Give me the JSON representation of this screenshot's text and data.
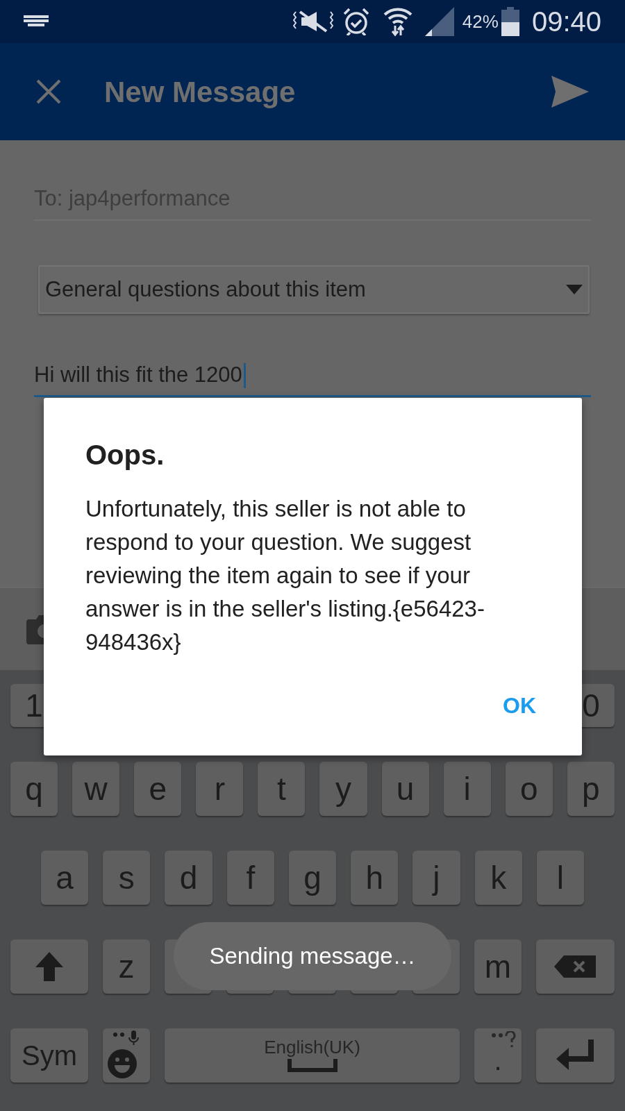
{
  "status_bar": {
    "battery": "42%",
    "time": "09:40"
  },
  "toolbar": {
    "title": "New Message"
  },
  "form": {
    "to": "To: jap4performance",
    "topic": "General questions about this item",
    "message": "Hi will this fit the 1200"
  },
  "keyboard": {
    "number_row": [
      "1",
      "0"
    ],
    "rows": [
      {
        "keys": [
          {
            "kind": "char",
            "label": "q"
          },
          {
            "kind": "char",
            "label": "w"
          },
          {
            "kind": "char",
            "label": "e"
          },
          {
            "kind": "char",
            "label": "r"
          },
          {
            "kind": "char",
            "label": "t"
          },
          {
            "kind": "char",
            "label": "y"
          },
          {
            "kind": "char",
            "label": "u"
          },
          {
            "kind": "char",
            "label": "i"
          },
          {
            "kind": "char",
            "label": "o"
          },
          {
            "kind": "char",
            "label": "p"
          }
        ]
      },
      {
        "keys": [
          {
            "kind": "char",
            "label": "a"
          },
          {
            "kind": "char",
            "label": "s"
          },
          {
            "kind": "char",
            "label": "d"
          },
          {
            "kind": "char",
            "label": "f"
          },
          {
            "kind": "char",
            "label": "g"
          },
          {
            "kind": "char",
            "label": "h"
          },
          {
            "kind": "char",
            "label": "j"
          },
          {
            "kind": "char",
            "label": "k"
          },
          {
            "kind": "char",
            "label": "l"
          }
        ]
      },
      {
        "keys": [
          {
            "kind": "shift"
          },
          {
            "kind": "char",
            "label": "z"
          },
          {
            "kind": "char"
          },
          {
            "kind": "char"
          },
          {
            "kind": "char"
          },
          {
            "kind": "char"
          },
          {
            "kind": "char"
          },
          {
            "kind": "char",
            "label": "m"
          },
          {
            "kind": "backspace"
          }
        ]
      },
      {
        "keys": [
          {
            "kind": "sym",
            "label": "Sym"
          },
          {
            "kind": "emoji"
          },
          {
            "kind": "space",
            "label": "English(UK)"
          },
          {
            "kind": "period",
            "label": "."
          },
          {
            "kind": "enter"
          }
        ]
      }
    ]
  },
  "dialog": {
    "title": "Oops.",
    "body": "Unfortunately, this seller is not able to respond to your question. We suggest reviewing the item again to see if your answer is in the seller's listing.{e56423-948436x}",
    "button": "OK"
  },
  "toast": "Sending message…"
}
